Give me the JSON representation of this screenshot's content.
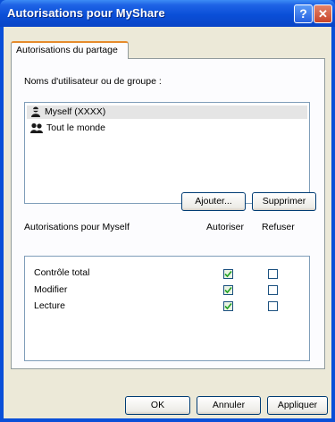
{
  "window": {
    "title": "Autorisations pour MyShare"
  },
  "titlebar": {
    "help_label": "?",
    "close_label": "✕"
  },
  "tab": {
    "label": "Autorisations du partage"
  },
  "users": {
    "label": "Noms d'utilisateur ou de groupe :",
    "items": [
      {
        "name": "Myself (XXXX)",
        "selected": true,
        "icon": "user-icon"
      },
      {
        "name": "Tout le monde",
        "selected": false,
        "icon": "group-icon"
      }
    ],
    "add_label": "Ajouter...",
    "remove_label": "Supprimer"
  },
  "permissions": {
    "label": "Autorisations pour Myself",
    "allow_header": "Autoriser",
    "deny_header": "Refuser",
    "rows": [
      {
        "name": "Contrôle total",
        "allow": true,
        "deny": false
      },
      {
        "name": "Modifier",
        "allow": true,
        "deny": false
      },
      {
        "name": "Lecture",
        "allow": true,
        "deny": false
      }
    ]
  },
  "footer": {
    "ok_label": "OK",
    "cancel_label": "Annuler",
    "apply_label": "Appliquer"
  }
}
